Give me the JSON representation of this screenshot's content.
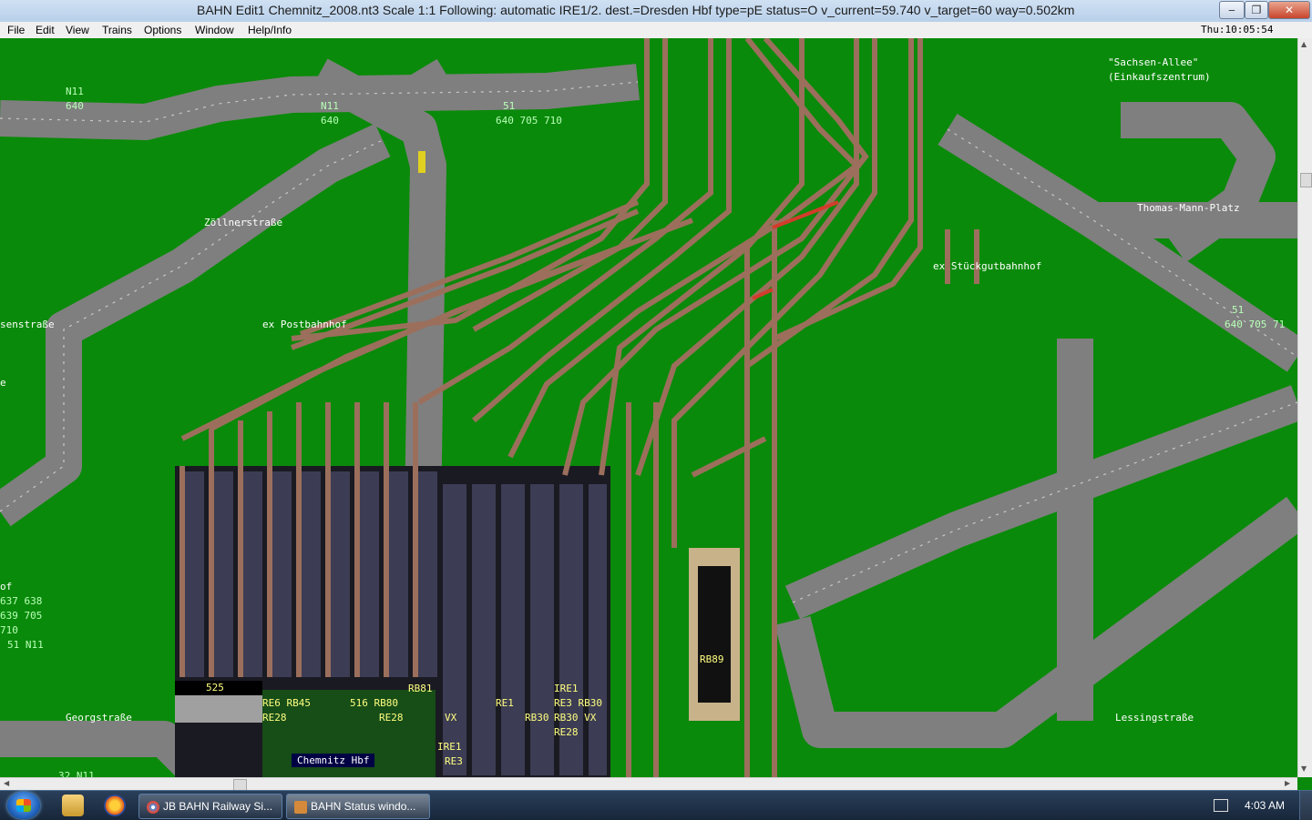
{
  "window": {
    "title": "BAHN Edit1 Chemnitz_2008.nt3 Scale 1:1 Following: automatic IRE1/2.  dest.=Dresden Hbf type=pE status=O  v_current=59.740 v_target=60 way=0.502km",
    "minimize": "‒",
    "maximize": "❐",
    "close": "✕"
  },
  "menu": {
    "items": [
      "File",
      "Edit",
      "View",
      "Trains",
      "Options",
      "Window",
      "Help/Info"
    ],
    "clock": "Thu:10:05:54"
  },
  "map": {
    "labels": {
      "n11_a": "N11",
      "n11_a_routes": "640",
      "n11_b": "N11",
      "n11_b_routes": "640",
      "l51_a": "51",
      "l51_a_routes": "640 705 710",
      "sachsen": "\"Sachsen-Allee\"",
      "einkauf": "(Einkaufszentrum)",
      "zoellner": "Zöllnerstraße",
      "thomas": "Thomas-Mann-Platz",
      "stueckgut": "ex Stückgutbahnhof",
      "senstr": "senstraße",
      "postbhf": "ex Postbahnhof",
      "l51_b": "51",
      "l51_b_routes": "640 705 71",
      "e_frag": "e",
      "of_frag": "of",
      "r637": "637 638",
      "r639": "639 705",
      "r710": "710",
      "r51n11": "51  N11",
      "georg": "Georgstraße",
      "lessing": "Lessingstraße",
      "chemnitz": "Chemnitz Hbf",
      "p525": "525",
      "re6": "RE6 RB45",
      "re28a": "RE28",
      "p516": "516 RB80",
      "re28b": "RE28",
      "rb81": "RB81",
      "vx1": "VX",
      "ire1a": "IRE1",
      "re3a": "RE3",
      "re1": "RE1",
      "rb30a": "RB30",
      "ire1b": "IRE1",
      "re3b": "RE3 RB30",
      "rb30b": "RB30  VX",
      "re28c": "RE28",
      "rb89": "RB89",
      "n11_c": "32  N11"
    },
    "colors": {
      "grass": "#0a8a0a",
      "road": "#7f7f7f",
      "track": "#9b6f5c",
      "platform": "#3c3c50"
    }
  },
  "taskbar": {
    "start": "start-button",
    "buttons": [
      "JB BAHN Railway Si...",
      "BAHN Status windo..."
    ],
    "time": "4:03 AM"
  }
}
